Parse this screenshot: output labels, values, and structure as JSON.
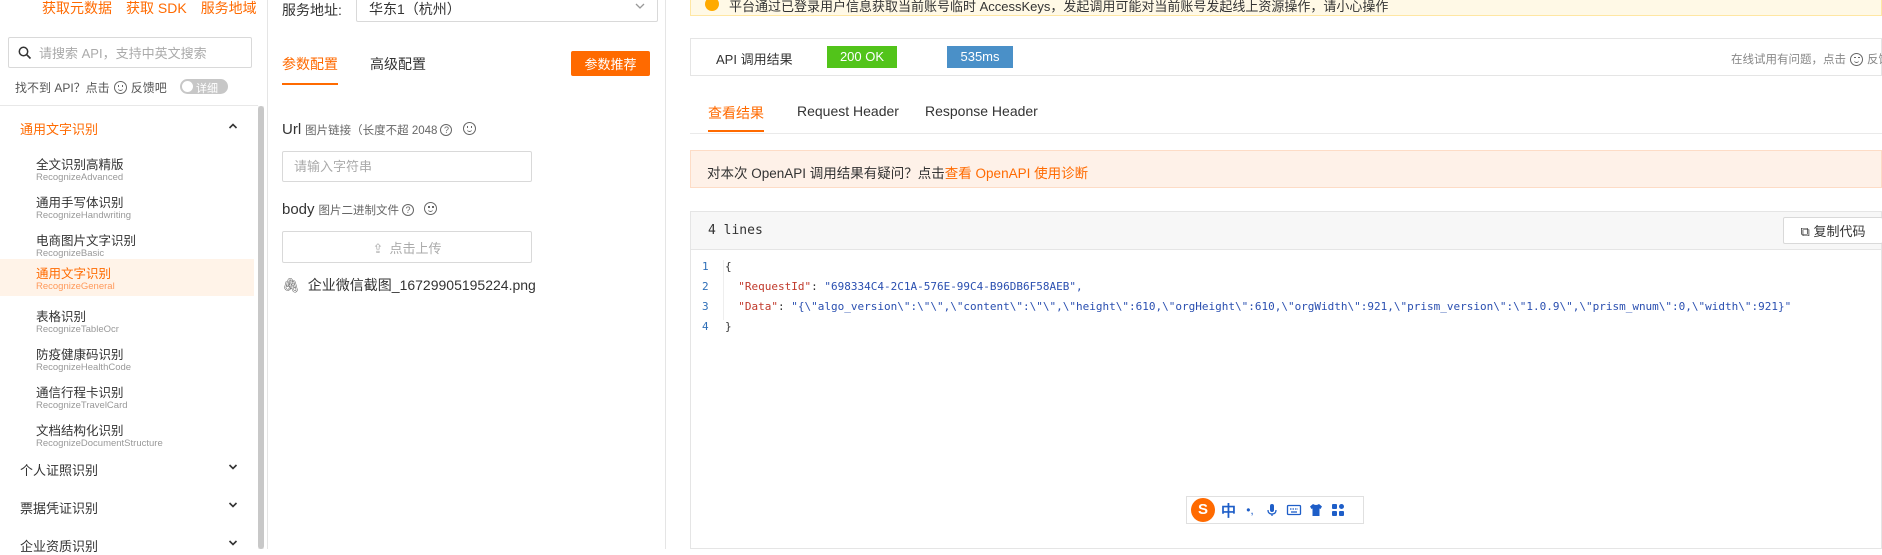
{
  "sidebar": {
    "top_links": [
      "获取元数据",
      "获取 SDK",
      "服务地域"
    ],
    "search_placeholder": "请搜索 API，支持中英文搜索",
    "no_api_text": "找不到 API？点击",
    "feedback_text": "反馈吧",
    "toggle_label": "详细",
    "categories_top": {
      "label": "通用文字识别",
      "expanded": true
    },
    "items": [
      {
        "zh": "全文识别高精版",
        "en": "RecognizeAdvanced"
      },
      {
        "zh": "通用手写体识别",
        "en": "RecognizeHandwriting"
      },
      {
        "zh": "电商图片文字识别",
        "en": "RecognizeBasic"
      },
      {
        "zh": "通用文字识别",
        "en": "RecognizeGeneral",
        "active": true
      },
      {
        "zh": "表格识别",
        "en": "RecognizeTableOcr"
      },
      {
        "zh": "防疫健康码识别",
        "en": "RecognizeHealthCode"
      },
      {
        "zh": "通信行程卡识别",
        "en": "RecognizeTravelCard"
      },
      {
        "zh": "文档结构化识别",
        "en": "RecognizeDocumentStructure"
      }
    ],
    "categories_bottom": [
      "个人证照识别",
      "票据凭证识别",
      "企业资质识别"
    ]
  },
  "middle": {
    "service_label": "服务地址:",
    "service_value": "华东1（杭州）",
    "tabs": [
      "参数配置",
      "高级配置"
    ],
    "recommend_button": "参数推荐",
    "params": [
      {
        "name": "Url",
        "desc": "图片链接（长度不超 2048",
        "input_placeholder": "请输入字符串"
      },
      {
        "name": "body",
        "desc": "图片二进制文件",
        "upload_label": "点击上传"
      }
    ],
    "uploaded_file": "企业微信截图_16729905195224.png"
  },
  "right": {
    "warning_text": "平台通过已登录用户信息获取当前账号临时 AccessKeys，发起调用可能对当前账号发起线上资源操作，请小心操作",
    "result_label": "API 调用结果",
    "status": "200 OK",
    "duration": "535ms",
    "problem_text": "在线试用有问题，点击",
    "problem_feedback": "反馈",
    "tabs": [
      "查看结果",
      "Request Header",
      "Response Header"
    ],
    "doubt_prefix": "对本次 OpenAPI 调用结果有疑问？点击",
    "doubt_link": "查看 OpenAPI 使用诊断",
    "code_lines_label": "4 lines",
    "copy_button": "复制代码",
    "code": {
      "line_numbers": [
        "1",
        "2",
        "3",
        "4"
      ],
      "open_brace": "{",
      "close_brace": "}",
      "request_id_key": "\"RequestId\"",
      "request_id_val": "\"698334C4-2C1A-576E-99C4-B96DB6F58AEB\",",
      "data_key": "\"Data\"",
      "data_val": "\"{\\\"algo_version\\\":\\\"\\\",\\\"content\\\":\\\"\\\",\\\"height\\\":610,\\\"orgHeight\\\":610,\\\"orgWidth\\\":921,\\\"prism_version\\\":\\\"1.0.9\\\",\\\"prism_wnum\\\":0,\\\"width\\\":921}\""
    },
    "colors": {
      "accent": "#ff6a00",
      "ok": "#52c41a",
      "time": "#4a90c8"
    }
  },
  "ime": {
    "logo": "S",
    "mode": "中",
    "punct": "•,"
  }
}
